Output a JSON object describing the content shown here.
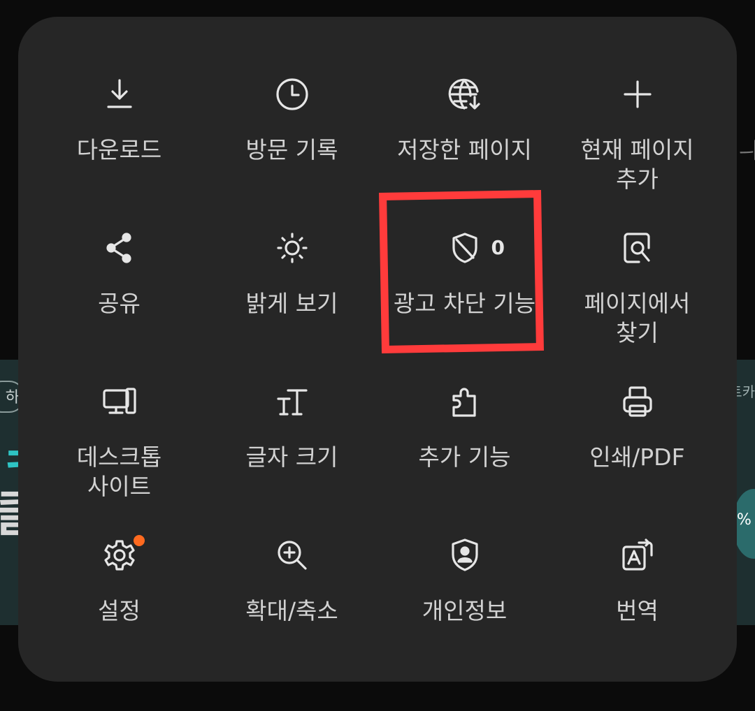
{
  "colors": {
    "panel_bg": "#262626",
    "icon": "#e6e6e6",
    "label": "#d2d2d2",
    "notification_dot": "#ff6a1f",
    "highlight": "#ff3b3b",
    "backdrop": "#0b0b0b"
  },
  "menu": {
    "items": [
      {
        "id": "download",
        "icon": "download-icon",
        "label": "다운로드"
      },
      {
        "id": "history",
        "icon": "clock-icon",
        "label": "방문 기록"
      },
      {
        "id": "saved-pages",
        "icon": "globe-download-icon",
        "label": "저장한 페이지"
      },
      {
        "id": "add-page",
        "icon": "plus-icon",
        "label": "현재 페이지\n추가"
      },
      {
        "id": "share",
        "icon": "share-icon",
        "label": "공유"
      },
      {
        "id": "brightness",
        "icon": "sun-icon",
        "label": "밝게 보기"
      },
      {
        "id": "ad-block",
        "icon": "shield-slash-icon",
        "label": "광고 차단 기능",
        "count": "0"
      },
      {
        "id": "find-in-page",
        "icon": "page-search-icon",
        "label": "페이지에서\n찾기"
      },
      {
        "id": "desktop-site",
        "icon": "desktop-icon",
        "label": "데스크톱\n사이트"
      },
      {
        "id": "text-size",
        "icon": "text-size-icon",
        "label": "글자 크기"
      },
      {
        "id": "add-ons",
        "icon": "puzzle-icon",
        "label": "추가 기능"
      },
      {
        "id": "print-pdf",
        "icon": "printer-icon",
        "label": "인쇄/PDF"
      },
      {
        "id": "settings",
        "icon": "gear-icon",
        "label": "설정",
        "has_notification": true
      },
      {
        "id": "zoom",
        "icon": "zoom-in-icon",
        "label": "확대/축소"
      },
      {
        "id": "privacy",
        "icon": "shield-person-icon",
        "label": "개인정보"
      },
      {
        "id": "translate",
        "icon": "translate-icon",
        "label": "번역"
      }
    ]
  },
  "background": {
    "pill_text": "하",
    "right_text": "트카",
    "badge_text": "%"
  }
}
